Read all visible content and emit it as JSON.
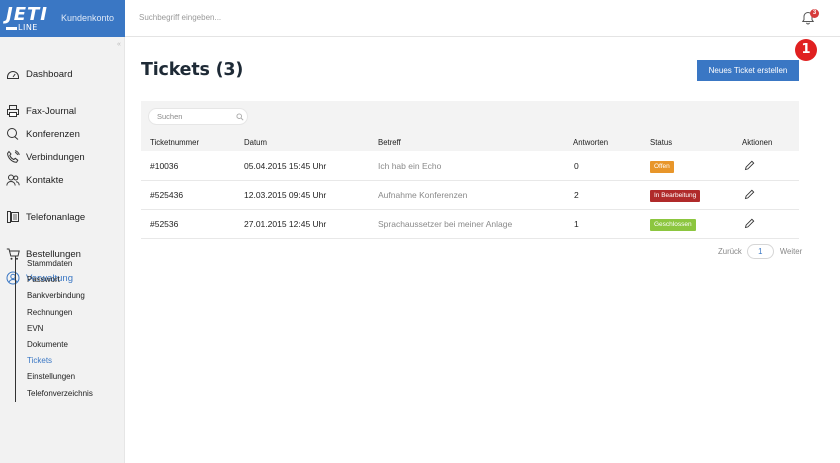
{
  "header": {
    "logo_main": "JETI",
    "logo_sub": "LINE",
    "account_label": "Kundenkonto",
    "search_placeholder": "Suchbegriff eingeben...",
    "notification_count": "3"
  },
  "sidebar": {
    "collapse_glyph": "«",
    "items": [
      {
        "label": "Dashboard",
        "icon": "dashboard-icon"
      },
      {
        "label": "Fax-Journal",
        "icon": "printer-icon"
      },
      {
        "label": "Konferenzen",
        "icon": "chat-icon"
      },
      {
        "label": "Verbindungen",
        "icon": "phone-icon"
      },
      {
        "label": "Kontakte",
        "icon": "users-icon"
      },
      {
        "label": "Telefonanlage",
        "icon": "phone-system-icon"
      },
      {
        "label": "Bestellungen",
        "icon": "cart-icon"
      },
      {
        "label": "Verwaltung",
        "icon": "user-circle-icon"
      }
    ],
    "subitems": [
      "Stammdaten",
      "Passwort",
      "Bankverbindung",
      "Rechnungen",
      "EVN",
      "Dokumente",
      "Tickets",
      "Einstellungen",
      "Telefonverzeichnis"
    ],
    "active_subitem": "Tickets"
  },
  "main": {
    "title": "Tickets (3)",
    "new_button_label": "Neues Ticket erstellen",
    "tip_marker": "1",
    "table_search_placeholder": "Suchen",
    "columns": [
      "Ticketnummer",
      "Datum",
      "Betreff",
      "Antworten",
      "Status",
      "Aktionen"
    ],
    "rows": [
      {
        "number": "#10036",
        "date": "05.04.2015 15:45 Uhr",
        "subject": "Ich hab ein Echo",
        "answers": "0",
        "status": "Offen",
        "status_color": "#e8962a"
      },
      {
        "number": "#525436",
        "date": "12.03.2015 09:45 Uhr",
        "subject": "Aufnahme Konferenzen",
        "answers": "2",
        "status": "In Bearbeitung",
        "status_color": "#b02a2a"
      },
      {
        "number": "#52536",
        "date": "27.01.2015 12:45 Uhr",
        "subject": "Sprachaussetzer bei meiner Anlage",
        "answers": "1",
        "status": "Geschlossen",
        "status_color": "#8cc63f"
      }
    ],
    "pagination": {
      "prev": "Zurück",
      "page": "1",
      "next": "Weiter"
    }
  },
  "colors": {
    "accent": "#3a77c4",
    "badge_red": "#e02020"
  }
}
